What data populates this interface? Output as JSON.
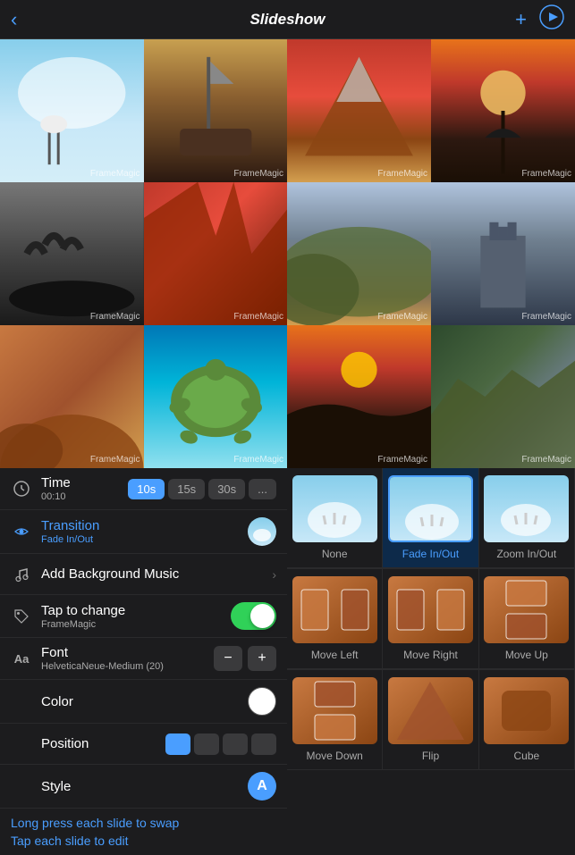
{
  "header": {
    "title": "Slideshow",
    "back_label": "‹",
    "add_label": "+",
    "play_label": "▶"
  },
  "photos": [
    {
      "id": 1,
      "watermark": "FrameMagic",
      "color_class": "img-stork"
    },
    {
      "id": 2,
      "watermark": "FrameMagic",
      "color_class": "img-ship"
    },
    {
      "id": 3,
      "watermark": "FrameMagic",
      "color_class": "img-mountain"
    },
    {
      "id": 4,
      "watermark": "FrameMagic",
      "color_class": "img-sunset-tree"
    },
    {
      "id": 5,
      "watermark": "FrameMagic",
      "color_class": "img-birds"
    },
    {
      "id": 6,
      "watermark": "FrameMagic",
      "color_class": "img-lava"
    },
    {
      "id": 7,
      "watermark": "FrameMagic",
      "color_class": "img-hills"
    },
    {
      "id": 8,
      "watermark": "FrameMagic",
      "color_class": "img-castle"
    },
    {
      "id": 9,
      "watermark": "FrameMagic",
      "color_class": "img-orange-hills"
    },
    {
      "id": 10,
      "watermark": "FrameMagic",
      "color_class": "img-turtle"
    },
    {
      "id": 11,
      "watermark": "FrameMagic",
      "color_class": "img-sunset2"
    },
    {
      "id": 12,
      "watermark": "FrameMagic",
      "color_class": "img-cliffs"
    }
  ],
  "settings": {
    "time_label": "Time",
    "time_value": "00:10",
    "time_options": [
      "10s",
      "15s",
      "30s",
      "..."
    ],
    "time_active": "10s",
    "transition_label": "Transition",
    "transition_value": "Fade In/Out",
    "music_label": "Add Background Music",
    "tap_to_change_label": "Tap to change",
    "tap_to_change_value": "FrameMagic",
    "font_label": "Font",
    "font_value": "HelveticaNeue-Medium (20)",
    "color_label": "Color",
    "position_label": "Position",
    "style_label": "Style",
    "style_badge": "A"
  },
  "bottom_links": {
    "swap_label": "Long press each slide to swap",
    "edit_label": "Tap each slide to edit"
  },
  "transitions": {
    "items": [
      {
        "label": "None",
        "selected": false,
        "thumb": "stork"
      },
      {
        "label": "Fade In/Out",
        "selected": true,
        "thumb": "stork"
      },
      {
        "label": "Zoom In/Out",
        "selected": false,
        "thumb": "stork"
      },
      {
        "label": "Move Left",
        "selected": false,
        "thumb": "arch"
      },
      {
        "label": "Move Right",
        "selected": false,
        "thumb": "arch"
      },
      {
        "label": "Move Up",
        "selected": false,
        "thumb": "arch"
      },
      {
        "label": "Move Down",
        "selected": false,
        "thumb": "arch"
      },
      {
        "label": "Flip",
        "selected": false,
        "thumb": "arch"
      },
      {
        "label": "Cube",
        "selected": false,
        "thumb": "arch"
      }
    ]
  }
}
